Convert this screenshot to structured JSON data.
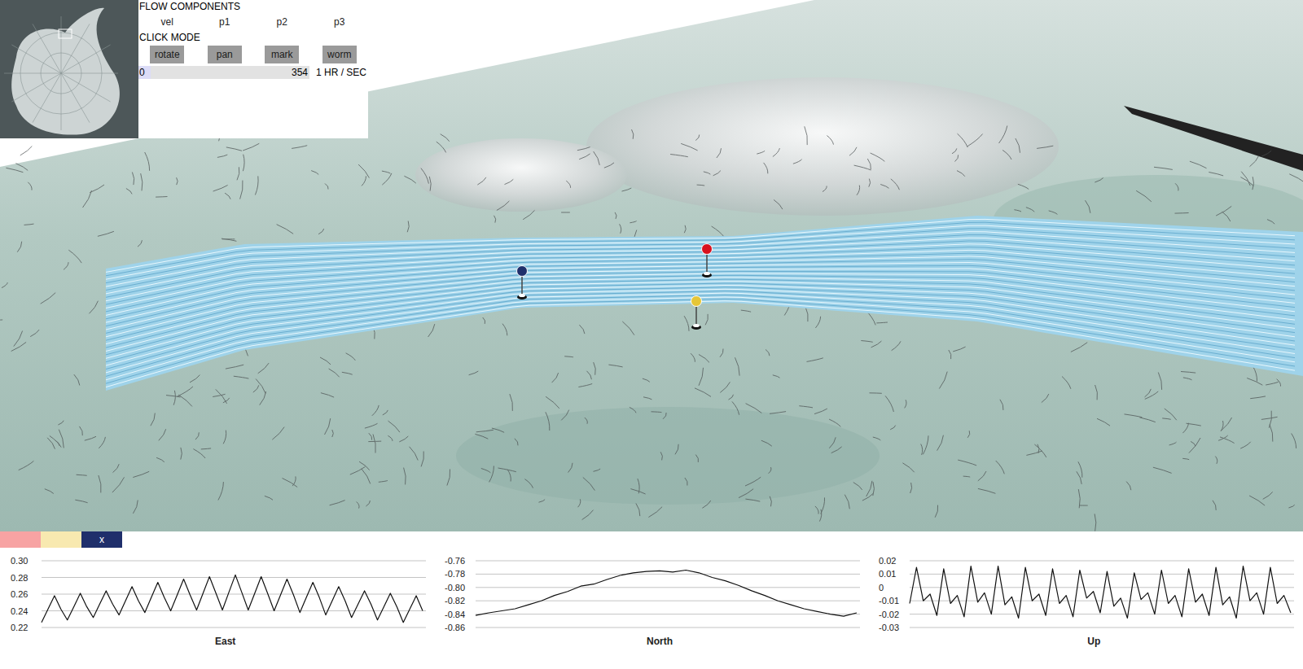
{
  "flow_components": {
    "title": "FLOW COMPONENTS",
    "items": [
      "vel",
      "p1",
      "p2",
      "p3"
    ]
  },
  "click_mode": {
    "title": "CLICK MODE",
    "buttons": [
      {
        "label": "rotate",
        "selected": false
      },
      {
        "label": "pan",
        "selected": false
      },
      {
        "label": "mark",
        "selected": false
      },
      {
        "label": "worm",
        "selected": false
      }
    ]
  },
  "time_slider": {
    "min": "0",
    "max": "354",
    "level": 0.07,
    "rate": "1 HR / SEC"
  },
  "markers": [
    {
      "pin_color": "#d8101e",
      "tab_color": "#f7a3a3",
      "tab_label": "",
      "selected": false
    },
    {
      "pin_color": "#e6c637",
      "tab_color": "#f8e9b0",
      "tab_label": "",
      "selected": false
    },
    {
      "pin_color": "#1f2f6b",
      "tab_color": "#1f2f6b",
      "tab_label": "x",
      "selected": true
    }
  ],
  "charts": [
    {
      "title": "East",
      "ticks": [
        "0.30",
        "0.28",
        "0.26",
        "0.24",
        "0.22"
      ],
      "values": [
        0.226,
        0.242,
        0.258,
        0.242,
        0.229,
        0.245,
        0.261,
        0.245,
        0.232,
        0.248,
        0.264,
        0.248,
        0.235,
        0.252,
        0.269,
        0.252,
        0.238,
        0.256,
        0.274,
        0.256,
        0.24,
        0.259,
        0.278,
        0.259,
        0.241,
        0.261,
        0.281,
        0.261,
        0.241,
        0.262,
        0.283,
        0.262,
        0.241,
        0.261,
        0.281,
        0.261,
        0.24,
        0.259,
        0.278,
        0.259,
        0.238,
        0.256,
        0.274,
        0.256,
        0.235,
        0.252,
        0.269,
        0.252,
        0.232,
        0.248,
        0.264,
        0.248,
        0.229,
        0.245,
        0.261,
        0.245,
        0.226,
        0.242,
        0.258,
        0.24
      ]
    },
    {
      "title": "North",
      "ticks": [
        "-0.76",
        "-0.78",
        "-0.80",
        "-0.82",
        "-0.84",
        "-0.86"
      ],
      "values": [
        -0.842,
        -0.838,
        -0.835,
        -0.832,
        -0.826,
        -0.82,
        -0.812,
        -0.806,
        -0.798,
        -0.795,
        -0.788,
        -0.782,
        -0.778,
        -0.776,
        -0.775,
        -0.777,
        -0.774,
        -0.778,
        -0.785,
        -0.79,
        -0.797,
        -0.805,
        -0.812,
        -0.82,
        -0.826,
        -0.832,
        -0.836,
        -0.84,
        -0.843,
        -0.838
      ]
    },
    {
      "title": "Up",
      "ticks": [
        "0.02",
        "0.01",
        "0",
        "-0.01",
        "-0.02",
        "-0.03"
      ],
      "values": [
        -0.012,
        0.015,
        -0.01,
        -0.005,
        -0.021,
        0.014,
        -0.012,
        -0.006,
        -0.022,
        0.016,
        -0.011,
        -0.004,
        -0.02,
        0.016,
        -0.013,
        -0.007,
        -0.023,
        0.015,
        -0.01,
        -0.005,
        -0.021,
        0.014,
        -0.012,
        -0.006,
        -0.022,
        0.013,
        -0.008,
        -0.003,
        -0.019,
        0.012,
        -0.014,
        -0.008,
        -0.023,
        0.011,
        -0.009,
        -0.004,
        -0.02,
        0.013,
        -0.012,
        -0.006,
        -0.022,
        0.014,
        -0.011,
        -0.005,
        -0.021,
        0.015,
        -0.013,
        -0.007,
        -0.023,
        0.016,
        -0.01,
        -0.004,
        -0.02,
        0.015,
        -0.012,
        -0.006,
        -0.019
      ]
    }
  ]
}
